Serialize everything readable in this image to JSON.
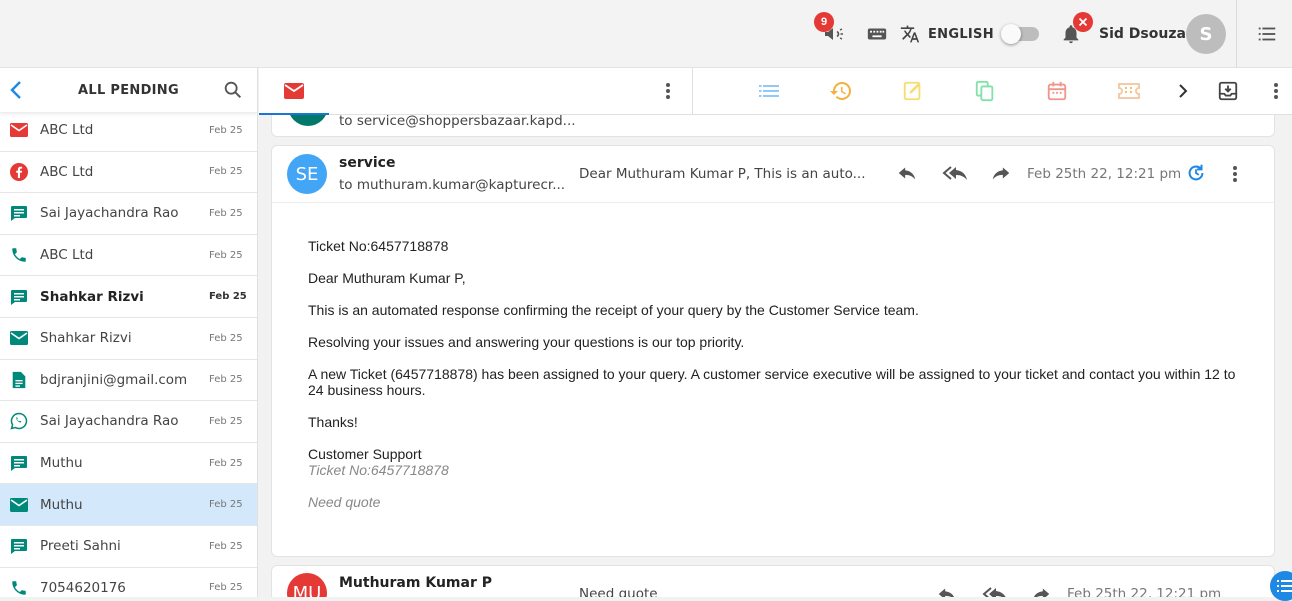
{
  "topbar": {
    "announcement_count": "9",
    "language": "ENGLISH",
    "user_name": "Sid Dsouza",
    "avatar_initial": "S"
  },
  "sidebar": {
    "title": "ALL PENDING",
    "items": [
      {
        "icon": "email-icon",
        "name": "ABC Ltd",
        "date": "Feb 25",
        "bold": false,
        "selected": false,
        "color": "#e53935"
      },
      {
        "icon": "facebook-icon",
        "name": "ABC Ltd",
        "date": "Feb 25",
        "bold": false,
        "selected": false,
        "color": "#e53935"
      },
      {
        "icon": "chat-icon",
        "name": "Sai Jayachandra Rao",
        "date": "Feb 25",
        "bold": false,
        "selected": false,
        "color": "#00897b"
      },
      {
        "icon": "phone-icon",
        "name": "ABC Ltd",
        "date": "Feb 25",
        "bold": false,
        "selected": false,
        "color": "#00897b"
      },
      {
        "icon": "chat-icon",
        "name": "Shahkar Rizvi",
        "date": "Feb 25",
        "bold": true,
        "selected": false,
        "color": "#00897b"
      },
      {
        "icon": "email-icon",
        "name": "Shahkar Rizvi",
        "date": "Feb 25",
        "bold": false,
        "selected": false,
        "color": "#00897b"
      },
      {
        "icon": "document-icon",
        "name": "bdjranjini@gmail.com",
        "date": "Feb 25",
        "bold": false,
        "selected": false,
        "color": "#00897b"
      },
      {
        "icon": "whatsapp-icon",
        "name": "Sai Jayachandra Rao",
        "date": "Feb 25",
        "bold": false,
        "selected": false,
        "color": "#00897b"
      },
      {
        "icon": "chat-icon",
        "name": "Muthu",
        "date": "Feb 25",
        "bold": false,
        "selected": false,
        "color": "#00897b"
      },
      {
        "icon": "email-icon",
        "name": "Muthu",
        "date": "Feb 25",
        "bold": false,
        "selected": true,
        "color": "#00897b"
      },
      {
        "icon": "chat-icon",
        "name": "Preeti Sahni",
        "date": "Feb 25",
        "bold": false,
        "selected": false,
        "color": "#00897b"
      },
      {
        "icon": "phone-icon",
        "name": "7054620176",
        "date": "Feb 25",
        "bold": false,
        "selected": false,
        "color": "#00897b"
      }
    ]
  },
  "colors": {
    "accent": "#1976d2",
    "selected_row": "#d3e9fb",
    "teal": "#00897b",
    "red": "#e53935"
  },
  "messages": {
    "prev": {
      "to": "to service@shoppersbazaar.kapd..."
    },
    "main": {
      "avatar": "SE",
      "sender": "service",
      "to": "to muthuram.kumar@kapturecr...",
      "snippet": "Dear Muthuram Kumar P, This is an auto...",
      "date": "Feb 25th 22, 12:21 pm",
      "body": {
        "ticket_line": "Ticket No:6457718878",
        "greeting": "Dear Muthuram Kumar P,",
        "p1": "This is an automated response confirming the receipt of your query by the Customer Service team.",
        "p2": "Resolving your issues and answering your questions is our top priority.",
        "p3": "A new Ticket (6457718878) has been assigned to your query. A customer service executive will be assigned to your ticket and contact you within 12 to 24 business hours.",
        "thanks": "Thanks!",
        "signature": "Customer Support",
        "sig_ticket": "Ticket No:6457718878",
        "quote": "Need quote"
      }
    },
    "next": {
      "avatar": "MU",
      "sender": "Muthuram Kumar P",
      "snippet": "Need quote",
      "date": "Feb 25th 22, 12:21 pm"
    }
  }
}
